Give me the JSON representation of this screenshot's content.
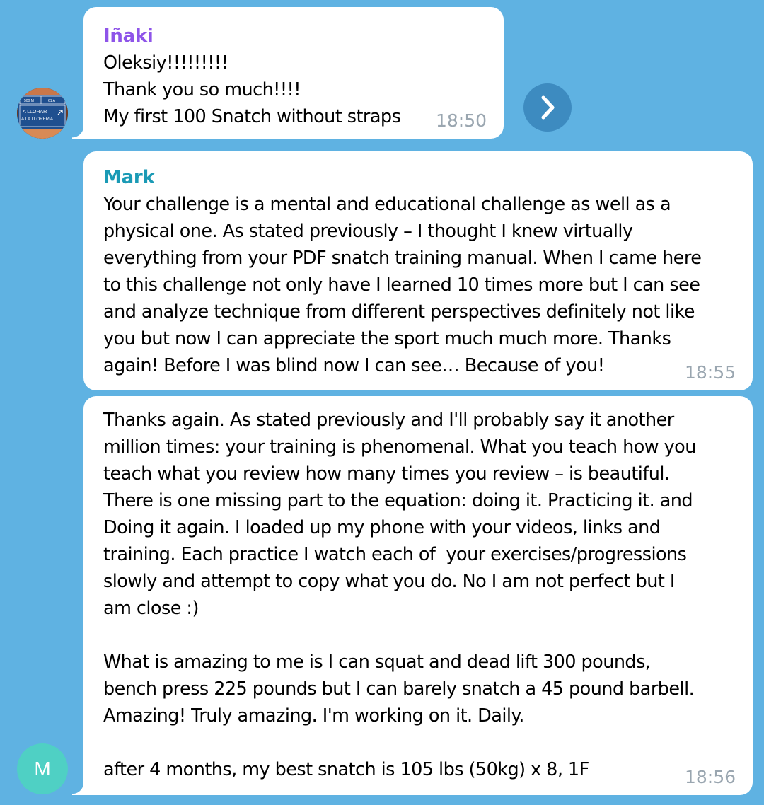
{
  "messages": [
    {
      "sender": "Iñaki",
      "sender_color": "#8e54e9",
      "lines": [
        "Oleksiy!!!!!!!!!",
        "Thank you so much!!!!",
        "My first 100 Snatch without straps"
      ],
      "time": "18:50"
    },
    {
      "sender": "Mark",
      "sender_color": "#1a9ab5",
      "lines": [
        "Your challenge is a mental and educational challenge as well as a",
        "physical one. As stated previously – I thought I knew virtually",
        "everything from your PDF snatch training manual. When I came here",
        "to this challenge not only have I learned 10 times more but I can see",
        "and analyze technique from different perspectives definitely not like",
        "you but now I can appreciate the sport much much more. Thanks",
        "again! Before I was blind now I can see… Because of you!"
      ],
      "time": "18:55"
    },
    {
      "lines": [
        "Thanks again. As stated previously and I'll probably say it another",
        "million times: your training is phenomenal. What you teach how you",
        "teach what you review how many times you review – is beautiful.",
        "There is one missing part to the equation: doing it. Practicing it. and",
        "Doing it again. I loaded up my phone with your videos, links and",
        "training. Each practice I watch each of  your exercises/progressions",
        "slowly and attempt to copy what you do. No I am not perfect but I",
        "am close :)",
        "",
        "What is amazing to me is I can squat and dead lift 300 pounds,",
        "bench press 225 pounds but I can barely snatch a 45 pound barbell.",
        "Amazing! Truly amazing. I'm working on it. Daily.",
        "",
        "after 4 months, my best snatch is 105 lbs (50kg) x 8, 1F"
      ],
      "time": "18:56"
    }
  ],
  "avatar_iñaki": {
    "icon": "road-sign-photo",
    "sign_texts": [
      "500 M",
      "61 A",
      "A LLORAR",
      "A LA LLORERIA"
    ]
  },
  "avatar_mark": {
    "initial": "M",
    "color": "#4fd0c4"
  },
  "forward_button": {
    "icon": "chevron-right-icon"
  },
  "colors": {
    "background": "#5fb2e2",
    "bubble": "#ffffff",
    "time": "#9aa6b0",
    "forward_button": "#3d8bc0"
  }
}
